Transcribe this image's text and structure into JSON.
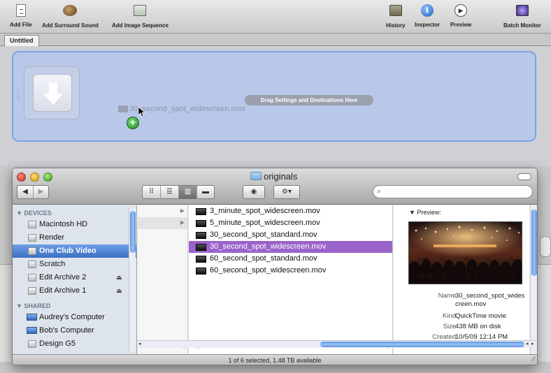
{
  "toolbar": {
    "add_file": "Add File",
    "add_surround_sound": "Add Surround Sound",
    "add_image_sequence": "Add Image Sequence",
    "history": "History",
    "inspector": "Inspector",
    "preview": "Preview",
    "batch_monitor": "Batch Monitor"
  },
  "tabs": {
    "active": "Untitled"
  },
  "drop_zone": {
    "hint": "Drag Settings and Destinations Here",
    "dragged_file": "30_second_spot_widescreen.mov"
  },
  "finder": {
    "title": "originals",
    "search_placeholder": "",
    "view_modes": [
      "icon",
      "list",
      "column",
      "coverflow"
    ],
    "sidebar": {
      "devices_header": "DEVICES",
      "devices": [
        {
          "label": "Macintosh HD",
          "eject": false
        },
        {
          "label": "Render",
          "eject": false
        },
        {
          "label": "One Club Video",
          "eject": false,
          "selected": true
        },
        {
          "label": "Scratch",
          "eject": false
        },
        {
          "label": "Edit Archive 2",
          "eject": true
        },
        {
          "label": "Edit Archive 1",
          "eject": true
        }
      ],
      "shared_header": "SHARED",
      "shared": [
        {
          "label": "Audrey's Computer"
        },
        {
          "label": "Bob's Computer"
        },
        {
          "label": "Design G5"
        }
      ]
    },
    "files": [
      {
        "name": "3_minute_spot_widescreen.mov"
      },
      {
        "name": "5_minute_spot_widescreen.mov"
      },
      {
        "name": "30_second_spot_standard.mov"
      },
      {
        "name": "30_second_spot_widescreen.mov",
        "selected": true
      },
      {
        "name": "60_second_spot_standard.mov"
      },
      {
        "name": "60_second_spot_widescreen.mov"
      }
    ],
    "preview": {
      "header": "Preview:",
      "name_label": "Name",
      "name_value": "30_second_spot_widescreen.mov",
      "kind_label": "Kind",
      "kind_value": "QuickTime movie",
      "size_label": "Size",
      "size_value": "438 MB on disk",
      "created_label": "Created",
      "created_value": "10/5/09 12:14 PM"
    },
    "status": "1 of 6 selected, 1.48 TB available"
  },
  "colors": {
    "selection_purple": "#9a63c9",
    "sidebar_selection": "#3b6fc2",
    "drop_zone_fill": "#b9c8e8"
  }
}
